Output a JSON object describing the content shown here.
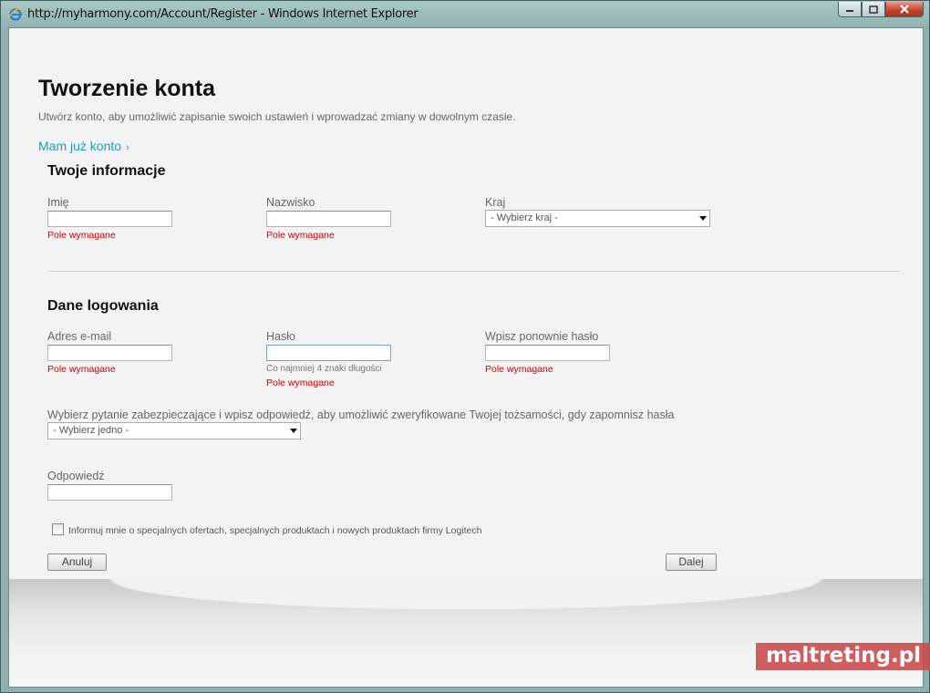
{
  "window": {
    "title": "http://myharmony.com/Account/Register - Windows Internet Explorer",
    "icon": "ie-icon"
  },
  "page": {
    "heading": "Tworzenie konta",
    "subtitle": "Utwórz konto, aby umożliwić zapisanie swoich ustawień i wprowadzać zmiany w dowolnym czasie.",
    "already_link": "Mam już konto",
    "already_chevron": "›"
  },
  "info_section": {
    "title": "Twoje informacje",
    "first_name": {
      "label": "Imię",
      "value": "",
      "error": "Pole wymagane"
    },
    "last_name": {
      "label": "Nazwisko",
      "value": "",
      "error": "Pole wymagane"
    },
    "country": {
      "label": "Kraj",
      "selected": "- Wybierz kraj -"
    }
  },
  "login_section": {
    "title": "Dane logowania",
    "email": {
      "label": "Adres e-mail",
      "value": "",
      "error": "Pole wymagane"
    },
    "password": {
      "label": "Hasło",
      "value": "",
      "hint": "Co najmniej 4 znaki długości",
      "error": "Pole wymagane"
    },
    "password_confirm": {
      "label": "Wpisz ponownie hasło",
      "value": "",
      "error": "Pole wymagane"
    },
    "security_question": {
      "label": "Wybierz pytanie zabezpieczające i wpisz odpowiedź, aby umożliwić zweryfikowane Twojej tożsamości, gdy zapomnisz hasła",
      "selected": "- Wybierz jedno -"
    },
    "answer": {
      "label": "Odpowiedź",
      "value": ""
    }
  },
  "newsletter": {
    "label": "Informuj mnie o specjalnych ofertach, specjalnych produktach i nowych produktach firmy Logitech",
    "checked": false
  },
  "buttons": {
    "cancel": "Anuluj",
    "next": "Dalej"
  },
  "watermark": "maltreting.pl",
  "colors": {
    "link": "#1ba0b7",
    "error": "#d00000",
    "watermark_bg": "#c94a4c"
  }
}
